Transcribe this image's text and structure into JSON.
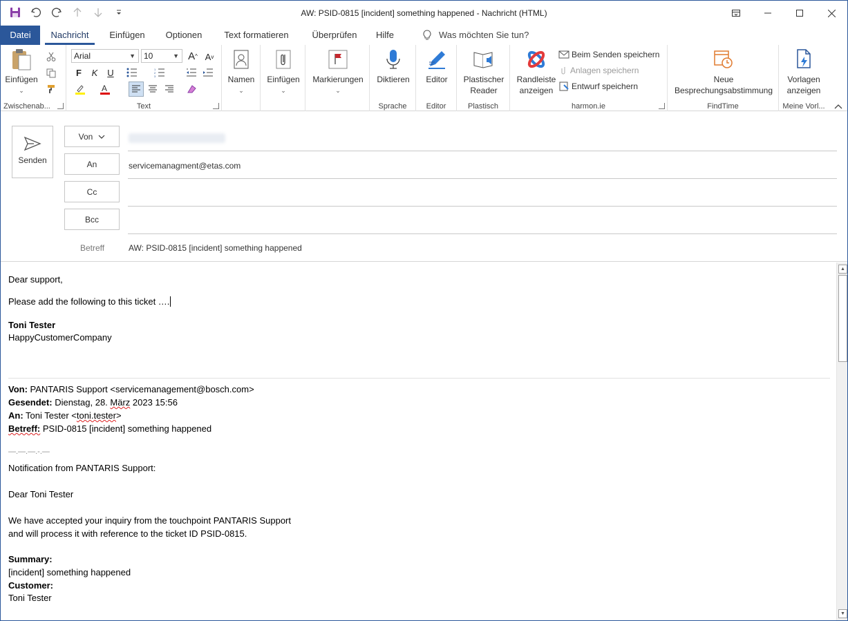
{
  "window": {
    "title": "AW: PSID-0815 [incident] something happened  -  Nachricht (HTML)"
  },
  "tabs": {
    "file": "Datei",
    "items": [
      "Nachricht",
      "Einfügen",
      "Optionen",
      "Text formatieren",
      "Überprüfen",
      "Hilfe"
    ],
    "active": "Nachricht",
    "tellme": "Was möchten Sie tun?"
  },
  "ribbon": {
    "clipboard": {
      "label": "Zwischenab...",
      "paste": "Einfügen"
    },
    "text": {
      "label": "Text",
      "font": "Arial",
      "size": "10",
      "bold": "F",
      "italic": "K",
      "underline": "U"
    },
    "names": {
      "label": "Namen"
    },
    "include": {
      "label": "Einfügen"
    },
    "tags": {
      "label": "Markierungen"
    },
    "voice": {
      "label": "Sprache",
      "dictate": "Diktieren"
    },
    "editor": {
      "label": "Editor",
      "button": "Editor"
    },
    "immersive": {
      "label": "Plastisch",
      "button_line1": "Plastischer",
      "button_line2": "Reader"
    },
    "harmon": {
      "label": "harmon.ie",
      "sidebar_line1": "Randleiste",
      "sidebar_line2": "anzeigen",
      "save_on_send": "Beim Senden speichern",
      "save_attachments": "Anlagen speichern",
      "save_draft": "Entwurf speichern"
    },
    "findtime": {
      "label": "FindTime",
      "button_line1": "Neue",
      "button_line2": "Besprechungsabstimmung"
    },
    "templates": {
      "label": "Meine Vorl...",
      "button_line1": "Vorlagen",
      "button_line2": "anzeigen"
    }
  },
  "compose": {
    "send": "Senden",
    "from_label": "Von",
    "to_label": "An",
    "to_value": "servicemanagment@etas.com",
    "cc_label": "Cc",
    "bcc_label": "Bcc",
    "subject_label": "Betreff",
    "subject_value": "AW: PSID-0815 [incident] something happened"
  },
  "body": {
    "greeting": "Dear support,",
    "request": "Please add the following to this ticket ….",
    "sig_name": "Toni Tester",
    "sig_company": "HappyCustomerCompany",
    "quote": {
      "from_label": "Von:",
      "from_value": " PANTARIS Support <servicemanagement@bosch.com>",
      "sent_label": "Gesendet:",
      "sent_value_pre": " Dienstag, 28. ",
      "sent_value_month": "März",
      "sent_value_post": " 2023 15:56",
      "to_label": "An:",
      "to_value_pre": " Toni Tester <",
      "to_value_addr": "toni.tester",
      "to_value_post": ">",
      "subject_label": "Betreff:",
      "subject_value": " PSID-0815 [incident] something happened"
    },
    "divider_text": "—.—.—.-.—",
    "notification": "Notification from PANTARIS Support:",
    "dear": "Dear Toni Tester",
    "accepted_1": "We have accepted your inquiry from the touchpoint PANTARIS Support",
    "accepted_2": "and will process it with reference to the ticket ID PSID-0815.",
    "summary_label": "Summary:",
    "summary_value": "[incident] something happened",
    "customer_label": "Customer:",
    "customer_value": "Toni Tester"
  },
  "colors": {
    "accent": "#2b579a",
    "save_purple": "#8b3fa8",
    "flag_red": "#c5282f",
    "mic_blue": "#2f7bd6",
    "findtime_orange": "#e07a2f"
  }
}
